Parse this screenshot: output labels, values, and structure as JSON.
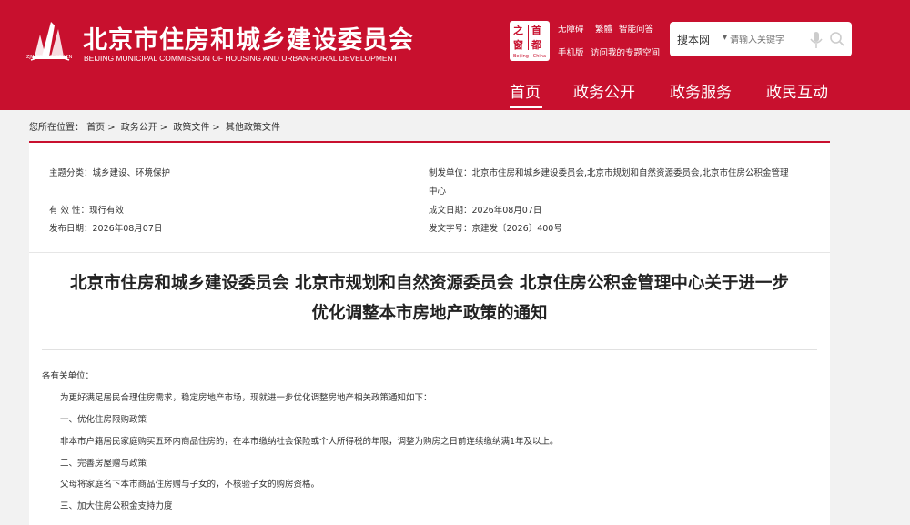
{
  "header": {
    "logo_url": "ZJW.BEIJING.GOV.CN",
    "title": "北京市住房和城乡建设委员会",
    "subtitle": "BEIJING MUNICIPAL COMMISSION OF HOUSING AND URBAN-RURAL DEVELOPMENT",
    "capital_logo": {
      "c1": "之",
      "c2": "首",
      "c3": "窗",
      "c4": "都",
      "sub": "Beijing · China"
    },
    "toplinks": [
      "无障碍",
      "繁體",
      "智能问答",
      "手机版",
      "访问我的专题空间"
    ],
    "search": {
      "scope": "搜本网",
      "placeholder": "请输入关键字"
    },
    "nav": [
      "首页",
      "政务公开",
      "政务服务",
      "政民互动"
    ],
    "brand_color": "#c8102e"
  },
  "breadcrumb": {
    "label": "您所在位置：",
    "items": [
      "首页",
      "政务公开",
      "政策文件",
      "其他政策文件"
    ],
    "separator": ">"
  },
  "meta": {
    "theme_label": "主题分类：",
    "theme_value": "城乡建设、环境保护",
    "validity_label": "有 效 性：",
    "validity_value": "现行有效",
    "publish_label": "发布日期：",
    "publish_value": "2026年08月07日",
    "issuer_label": "制发单位：",
    "issuer_value_line1": "北京市住房和城乡建设委员会,北京市规划和自然资源委员会,北京市住房公积金管理",
    "issuer_value_line2": "中心",
    "created_label": "成文日期：",
    "created_value": "2026年08月07日",
    "docno_label": "发文字号：",
    "docno_value": "京建发〔2026〕400号"
  },
  "document": {
    "title_line1": "北京市住房和城乡建设委员会 北京市规划和自然资源委员会 北京住房公积金管理中心关于进一步",
    "title_line2": "优化调整本市房地产政策的通知",
    "paragraphs": [
      "各有关单位：",
      "为更好满足居民合理住房需求，稳定房地产市场，现就进一步优化调整房地产相关政策通知如下：",
      "一、优化住房限购政策",
      "非本市户籍居民家庭购买五环内商品住房的，在本市缴纳社会保险或个人所得税的年限，调整为购房之日前连续缴纳满1年及以上。",
      "二、完善房屋赠与政策",
      "父母将家庭名下本市商品住房赠与子女的，不核验子女的购房资格。",
      "三、加大住房公积金支持力度"
    ]
  }
}
